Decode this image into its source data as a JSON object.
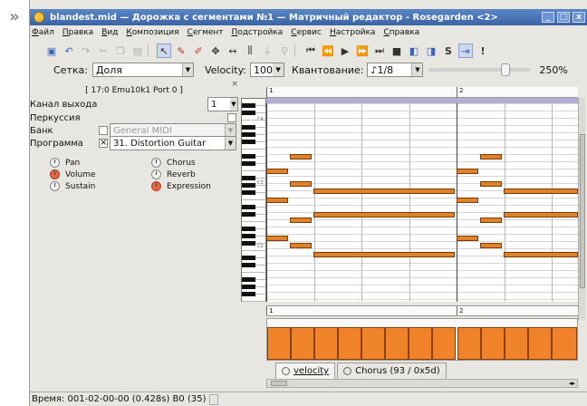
{
  "page": {
    "nav_arrow": "»"
  },
  "window": {
    "title": "blandest.mid — Дорожка с сегментами №1 — Матричный редактор - Rosegarden <2>",
    "buttons": [
      "_",
      "□",
      "x"
    ]
  },
  "menu": [
    "Файл",
    "Правка",
    "Вид",
    "Композиция",
    "Сегмент",
    "Подстройка",
    "Сервис",
    "Настройка",
    "Справка"
  ],
  "options": {
    "grid_label": "Сетка:",
    "grid_value": "Доля",
    "velocity_label": "Velocity:",
    "velocity_value": "100",
    "quantize_label": "Квантование:",
    "quantize_value": "♪1/8",
    "zoom_value": "250%",
    "zoom_fraction": 0.78
  },
  "left_panel": {
    "close_glyph": "×",
    "header": "[ 17:0 Emu10k1 Port 0 ]",
    "channel_label": "Канал выхода",
    "channel_value": "1",
    "percussion_label": "Перкуссия",
    "bank_label": "Банк",
    "bank_value": "General MIDI",
    "program_label": "Программа",
    "program_value": "31. Distortion Guitar",
    "controls": [
      {
        "label": "Pan",
        "icon": "pan-knob-icon",
        "active": false
      },
      {
        "label": "Chorus",
        "icon": "chorus-knob-icon",
        "active": false
      },
      {
        "label": "Volume",
        "icon": "volume-knob-icon",
        "active": true
      },
      {
        "label": "Reverb",
        "icon": "reverb-knob-icon",
        "active": false
      },
      {
        "label": "Sustain",
        "icon": "sustain-knob-icon",
        "active": false
      },
      {
        "label": "Expression",
        "icon": "expression-knob-icon",
        "active": true
      }
    ]
  },
  "editor": {
    "bars": [
      "1",
      "2"
    ],
    "keyboard_labels": [
      "C4",
      "C3",
      "C2"
    ],
    "note_color": "#e0822c",
    "segment_color": "#b6aed2"
  },
  "controller_tabs": [
    "velocity",
    "Chorus (93 / 0x5d)"
  ],
  "status": {
    "text": "Время: 001-02-00-00 (0.428s) B0 (35)"
  }
}
